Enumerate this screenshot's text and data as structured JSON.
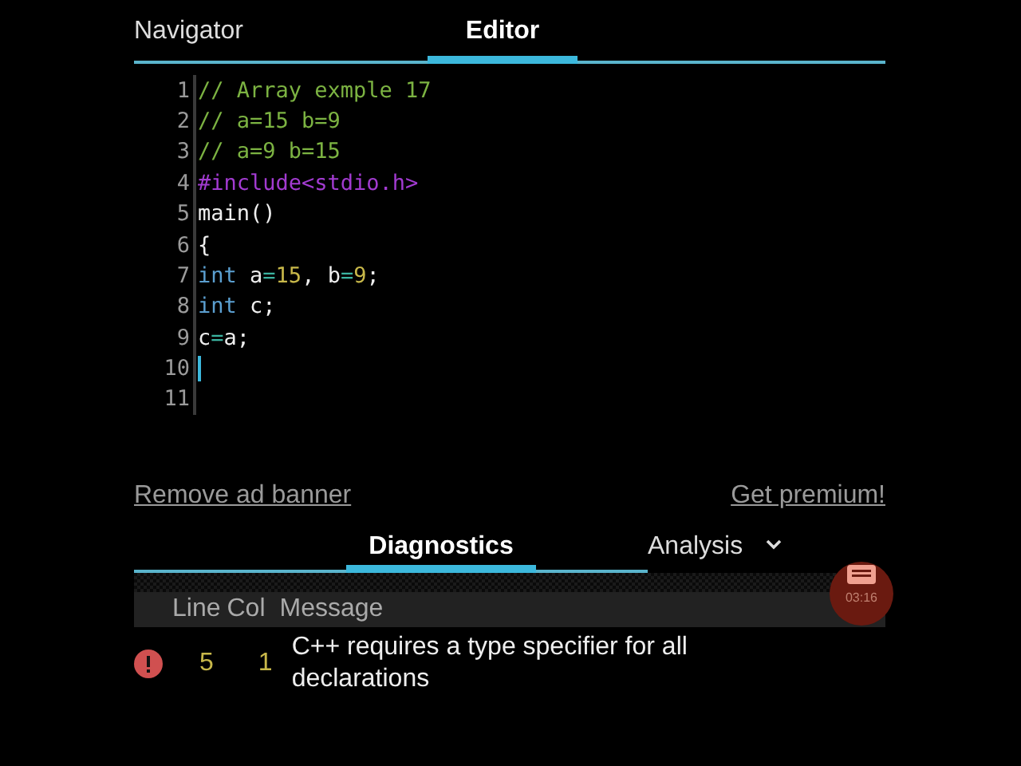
{
  "tabs": [
    {
      "label": "Navigator",
      "selected": false
    },
    {
      "label": "Editor",
      "selected": true
    }
  ],
  "code_lines": [
    {
      "number": "1",
      "tokens": [
        {
          "kind": "comment",
          "text": "// Array exmple 17"
        }
      ]
    },
    {
      "number": "2",
      "tokens": [
        {
          "kind": "comment",
          "text": "// a=15 b=9"
        }
      ]
    },
    {
      "number": "3",
      "tokens": [
        {
          "kind": "comment",
          "text": "// a=9 b=15"
        }
      ]
    },
    {
      "number": "4",
      "tokens": [
        {
          "kind": "preprocessor",
          "text": "#include<stdio.h>"
        }
      ]
    },
    {
      "number": "5",
      "tokens": [
        {
          "kind": "plain",
          "text": "main()"
        }
      ]
    },
    {
      "number": "6",
      "tokens": [
        {
          "kind": "plain",
          "text": "{"
        }
      ]
    },
    {
      "number": "7",
      "tokens": [
        {
          "kind": "keyword",
          "text": "int"
        },
        {
          "kind": "plain",
          "text": " a"
        },
        {
          "kind": "operator",
          "text": "="
        },
        {
          "kind": "number",
          "text": "15"
        },
        {
          "kind": "plain",
          "text": ", b"
        },
        {
          "kind": "operator",
          "text": "="
        },
        {
          "kind": "number",
          "text": "9"
        },
        {
          "kind": "plain",
          "text": ";"
        }
      ]
    },
    {
      "number": "8",
      "tokens": [
        {
          "kind": "keyword",
          "text": "int"
        },
        {
          "kind": "plain",
          "text": " c;"
        }
      ]
    },
    {
      "number": "9",
      "tokens": [
        {
          "kind": "plain",
          "text": "c"
        },
        {
          "kind": "operator",
          "text": "="
        },
        {
          "kind": "plain",
          "text": "a;"
        }
      ]
    },
    {
      "number": "10",
      "cursor": true
    },
    {
      "number": "11"
    }
  ],
  "links": [
    "Remove ad banner",
    "Get premium!"
  ],
  "bottom_tabs": [
    {
      "label": "Diagnostics",
      "selected": true
    },
    {
      "label": "Analysis",
      "selected": false
    }
  ],
  "recorder": {
    "time": "03:16"
  },
  "diagnostics": {
    "columns": [
      "Line",
      "Col",
      "Message"
    ],
    "rows": [
      {
        "kind": "error",
        "line": "5",
        "col": "1",
        "message": "C++ requires a type specifier for all declarations"
      }
    ]
  }
}
